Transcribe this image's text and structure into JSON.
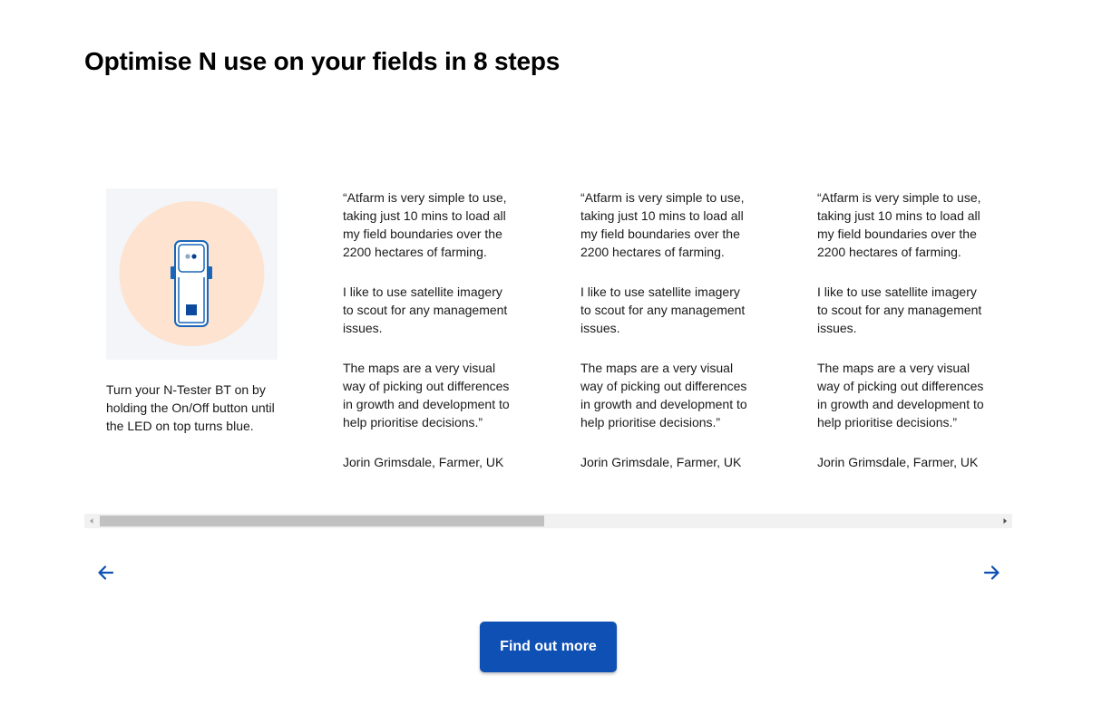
{
  "section": {
    "title": "Optimise N use on your fields in 8 steps"
  },
  "step_card": {
    "image_icon": "n-tester-device-icon",
    "caption": "Turn your N-Tester BT on by holding the On/Off button until the LED on top turns blue."
  },
  "testimonials": [
    {
      "paragraph_1": "“Atfarm is very simple to use, taking just 10 mins to load all my field boundaries over the 2200 hectares of farming.",
      "paragraph_2": "I like to use satellite imagery to scout for any management issues.",
      "paragraph_3": "The maps are a very visual way of picking out differences in growth and development to help prioritise decisions.”",
      "author": "Jorin Grimsdale, Farmer, UK"
    },
    {
      "paragraph_1": "“Atfarm is very simple to use, taking just 10 mins to load all my field boundaries over the 2200 hectares of farming.",
      "paragraph_2": "I like to use satellite imagery to scout for any management issues.",
      "paragraph_3": "The maps are a very visual way of picking out differences in growth and development to help prioritise decisions.”",
      "author": "Jorin Grimsdale, Farmer, UK"
    },
    {
      "paragraph_1": "“Atfarm is very simple to use, taking just 10 mins to load all my field boundaries over the 2200 hectares of farming.",
      "paragraph_2": "I like to use satellite imagery to scout for any management issues.",
      "paragraph_3": "The maps are a very visual way of picking out differences in growth and development to help prioritise decisions.”",
      "author": "Jorin Grimsdale, Farmer, UK"
    }
  ],
  "carousel": {
    "scroll_position": 0.47,
    "prev_icon": "arrow-left-icon",
    "next_icon": "arrow-right-icon"
  },
  "cta": {
    "label": "Find out more"
  },
  "colors": {
    "brand_blue": "#0f50b4",
    "illustration_circle": "#fde3d0",
    "illustration_bg": "#f3f5f9"
  }
}
